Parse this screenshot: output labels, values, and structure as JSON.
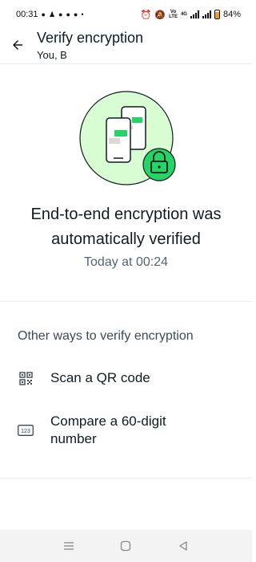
{
  "status_bar": {
    "time": "00:31",
    "battery": "84%",
    "notification_icons": [
      "facebook-icon",
      "person-icon",
      "messenger-icon",
      "chat-icon",
      "facebook-icon",
      "facebook-icon"
    ],
    "system_icons": [
      "alarm-icon",
      "mute-icon",
      "volte-icon",
      "signal-icon",
      "signal-icon",
      "battery-icon"
    ],
    "volte_label_top": "Vo",
    "volte_label_bottom": "LTE",
    "network_label": "4G"
  },
  "header": {
    "title": "Verify encryption",
    "subtitle": "You, B",
    "back_icon": "arrow-left-icon"
  },
  "hero": {
    "title": "End-to-end encryption was automatically verified",
    "timestamp": "Today at 00:24"
  },
  "other_ways": {
    "heading": "Other ways to verify encryption",
    "options": [
      {
        "icon": "qr-code-icon",
        "label": "Scan a QR code"
      },
      {
        "icon": "number-icon",
        "label": "Compare a 60-digit number",
        "icon_text": "123"
      }
    ]
  },
  "nav_bar": {
    "items": [
      "menu-icon",
      "home-icon",
      "back-icon"
    ]
  },
  "colors": {
    "brand_green": "#25d366",
    "dark_green": "#1fa855",
    "circle_bg": "#d9fdd3"
  }
}
